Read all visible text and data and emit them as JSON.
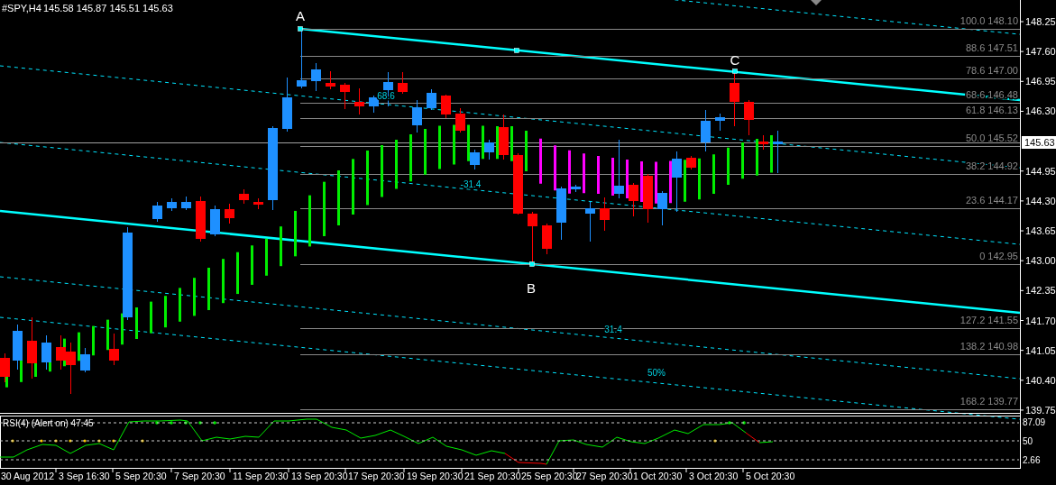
{
  "header": {
    "symbol": "#SPY,H4",
    "ohlc": "145.58 145.87 145.51 145.63"
  },
  "wave_labels": [
    {
      "label": "A"
    },
    {
      "label": "B"
    },
    {
      "label": "C"
    }
  ],
  "fib_levels": [
    {
      "label": "100.0 148.10"
    },
    {
      "label": "88.6 147.51"
    },
    {
      "label": "78.6 147.00"
    },
    {
      "label": "68.6 146.48"
    },
    {
      "label": "61.8 146.13"
    },
    {
      "label": "50.0 145.52"
    },
    {
      "label": "38.2 144.92"
    },
    {
      "label": "23.6 144.17"
    },
    {
      "label": "0 142.95"
    },
    {
      "label": "127.2 141.55"
    },
    {
      "label": "138.2 140.98"
    },
    {
      "label": "168.2 139.77"
    }
  ],
  "channel_labels": [
    "68.6",
    "-31.4",
    "31.4",
    "50%"
  ],
  "price_axis": {
    "ticks": [
      "148.25",
      "147.60",
      "146.95",
      "146.30",
      "144.95",
      "144.30",
      "143.65",
      "143.00",
      "142.35",
      "141.70",
      "141.05",
      "140.40",
      "139.75"
    ],
    "current": "145.63"
  },
  "rsi": {
    "label": "RSI(4) (Alert on) 47.45",
    "ticks": [
      "87.09",
      "50",
      "2.66"
    ]
  },
  "time_axis": [
    "30 Aug 2012",
    "3 Sep 16:30",
    "5 Sep 20:30",
    "7 Sep 20:30",
    "11 Sep 20:30",
    "13 Sep 20:30",
    "17 Sep 20:30",
    "19 Sep 20:30",
    "21 Sep 20:30",
    "25 Sep 20:30",
    "27 Sep 20:30",
    "1 Oct 20:30",
    "3 Oct 20:30",
    "5 Oct 20:30"
  ]
}
